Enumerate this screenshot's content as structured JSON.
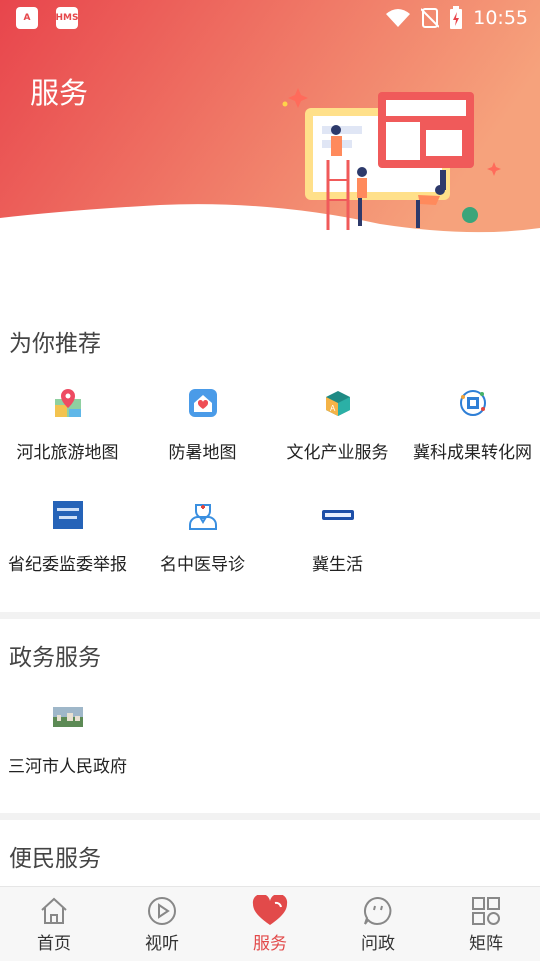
{
  "status_bar": {
    "time": "10:55",
    "apps": [
      "A",
      "HMS"
    ]
  },
  "header": {
    "title": "服务"
  },
  "sections": {
    "recommend": {
      "title": "为你推荐",
      "items": [
        {
          "label": "河北旅游地图",
          "icon": "map-pin-icon"
        },
        {
          "label": "防暑地图",
          "icon": "heart-house-icon"
        },
        {
          "label": "文化产业服务",
          "icon": "cube-icon"
        },
        {
          "label": "冀科成果转化网",
          "icon": "network-icon"
        },
        {
          "label": "省纪委监委举报",
          "icon": "report-badge-icon"
        },
        {
          "label": "名中医导诊",
          "icon": "doctor-icon"
        },
        {
          "label": "冀生活",
          "icon": "ji-life-logo-icon"
        }
      ]
    },
    "government": {
      "title": "政务服务",
      "items": [
        {
          "label": "三河市人民政府",
          "icon": "city-photo-icon"
        }
      ]
    },
    "convenience": {
      "title": "便民服务"
    }
  },
  "tabbar": {
    "active": "服务",
    "tabs": [
      {
        "label": "首页",
        "icon": "home-icon"
      },
      {
        "label": "视听",
        "icon": "play-icon"
      },
      {
        "label": "服务",
        "icon": "heart-icon"
      },
      {
        "label": "问政",
        "icon": "chat-icon"
      },
      {
        "label": "矩阵",
        "icon": "grid-icon"
      }
    ]
  },
  "colors": {
    "accent": "#e24a4a",
    "header_gradient_start": "#e8454c",
    "header_gradient_end": "#f6a27c"
  }
}
